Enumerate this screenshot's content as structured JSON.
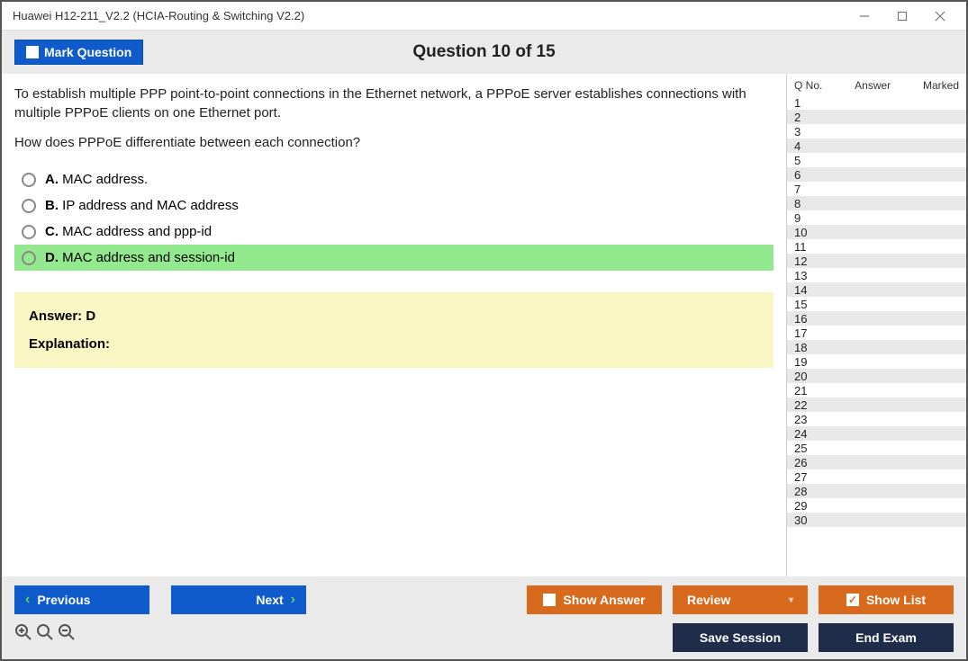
{
  "window": {
    "title": "Huawei H12-211_V2.2 (HCIA-Routing & Switching V2.2)"
  },
  "header": {
    "mark_label": "Mark Question",
    "question_title": "Question 10 of 15"
  },
  "question": {
    "text_line1": "To establish multiple PPP point-to-point connections in the Ethernet network, a PPPoE server establishes connections with multiple PPPoE clients on one Ethernet port.",
    "text_line2": "How does PPPoE differentiate between each connection?",
    "options": [
      {
        "letter": "A.",
        "text": "MAC address.",
        "highlight": false
      },
      {
        "letter": "B.",
        "text": "IP address and MAC address",
        "highlight": false
      },
      {
        "letter": "C.",
        "text": "MAC address and ppp-id",
        "highlight": false
      },
      {
        "letter": "D.",
        "text": "MAC address and session-id",
        "highlight": true
      }
    ],
    "answer_label": "Answer: D",
    "explanation_label": "Explanation:"
  },
  "sidebar": {
    "col_qno": "Q No.",
    "col_answer": "Answer",
    "col_marked": "Marked",
    "rows": [
      1,
      2,
      3,
      4,
      5,
      6,
      7,
      8,
      9,
      10,
      11,
      12,
      13,
      14,
      15,
      16,
      17,
      18,
      19,
      20,
      21,
      22,
      23,
      24,
      25,
      26,
      27,
      28,
      29,
      30
    ]
  },
  "footer": {
    "previous": "Previous",
    "next": "Next",
    "show_answer": "Show Answer",
    "review": "Review",
    "show_list": "Show List",
    "save_session": "Save Session",
    "end_exam": "End Exam"
  }
}
